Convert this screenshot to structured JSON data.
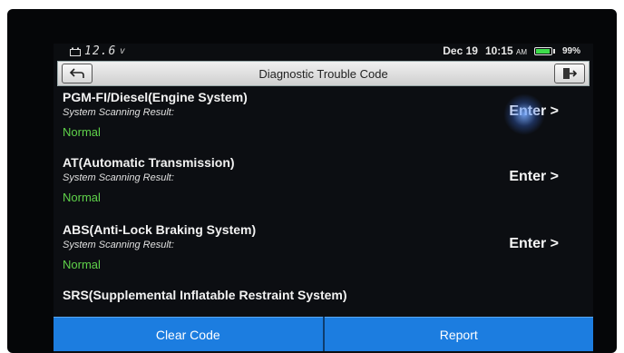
{
  "status_bar": {
    "voltage": "12.6",
    "voltage_unit": "v",
    "date": "Dec 19",
    "time": "10:15",
    "ampm": "AM",
    "battery_percent": "99%",
    "battery_level": 0.99,
    "battery_color": "#3ddc4b"
  },
  "header": {
    "title": "Diagnostic Trouble Code",
    "back_icon": "back-arrow-icon",
    "exit_icon": "exit-door-icon"
  },
  "systems": [
    {
      "name": "PGM-FI/Diesel(Engine System)",
      "scan_label": "System Scanning Result:",
      "result": "Normal",
      "action": "Enter >"
    },
    {
      "name": "AT(Automatic Transmission)",
      "scan_label": "System Scanning Result:",
      "result": "Normal",
      "action": "Enter >"
    },
    {
      "name": "ABS(Anti-Lock Braking System)",
      "scan_label": "System Scanning Result:",
      "result": "Normal",
      "action": "Enter >"
    },
    {
      "name": "SRS(Supplemental Inflatable Restraint System)"
    }
  ],
  "footer": {
    "clear_code": "Clear Code",
    "report": "Report"
  },
  "colors": {
    "accent_blue": "#1c7de0",
    "status_normal": "#5fd24a"
  }
}
